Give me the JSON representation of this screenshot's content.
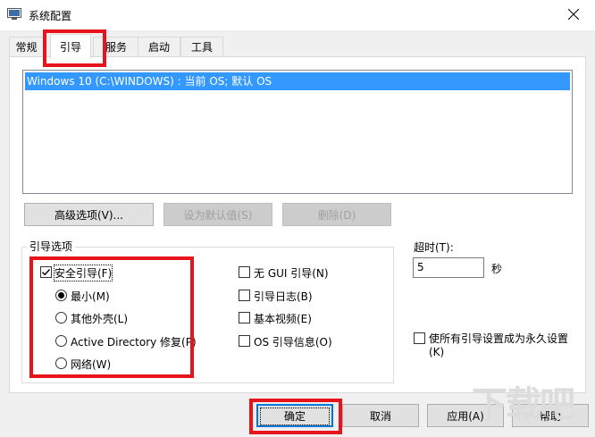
{
  "window": {
    "title": "系统配置"
  },
  "tabs": [
    {
      "label": "常规"
    },
    {
      "label": "引导"
    },
    {
      "label": "服务"
    },
    {
      "label": "启动"
    },
    {
      "label": "工具"
    }
  ],
  "os_list": {
    "items": [
      "Windows 10 (C:\\WINDOWS) : 当前 OS; 默认 OS"
    ]
  },
  "buttons": {
    "advanced": "高级选项(V)...",
    "set_default": "设为默认值(S)",
    "delete": "删除(D)"
  },
  "boot_options": {
    "label": "引导选项",
    "safe_boot": {
      "label": "安全引导(F)",
      "checked": true
    },
    "radios": [
      {
        "label": "最小(M)",
        "selected": true
      },
      {
        "label": "其他外壳(L)",
        "selected": false
      },
      {
        "label": "Active Directory 修复(P)",
        "selected": false
      },
      {
        "label": "网络(W)",
        "selected": false
      }
    ],
    "right_checks": [
      {
        "label": "无 GUI 引导(N)",
        "checked": false
      },
      {
        "label": "引导日志(B)",
        "checked": false
      },
      {
        "label": "基本视频(E)",
        "checked": false
      },
      {
        "label": "OS 引导信息(O)",
        "checked": false
      }
    ]
  },
  "timeout": {
    "label": "超时(T):",
    "value": "5",
    "unit": "秒"
  },
  "permanent": {
    "line1": "使所有引导设置成为永久设置",
    "line2": "(K)",
    "checked": false
  },
  "footer": {
    "ok": "确定",
    "cancel": "取消",
    "apply": "应用(A)",
    "help": "帮助"
  },
  "watermark": "下载吧",
  "colors": {
    "selection": "#3399ff",
    "highlight": "#e8141b",
    "focus": "#0078d7"
  }
}
